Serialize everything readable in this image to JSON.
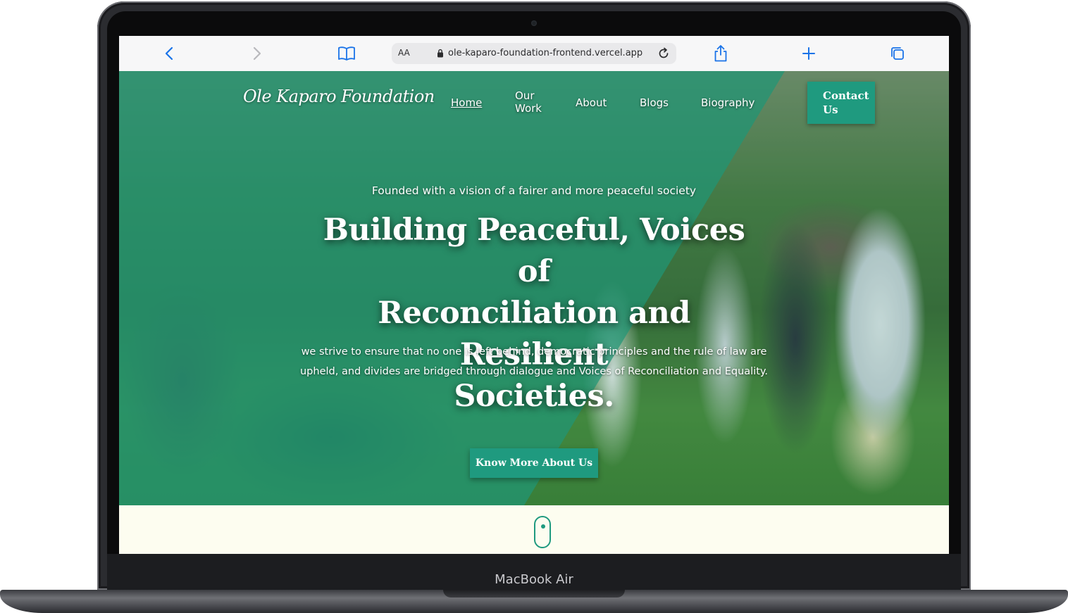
{
  "device": {
    "model_label": "MacBook Air"
  },
  "browser": {
    "address_prefix": "AA",
    "url": "ole-kaparo-foundation-frontend.vercel.app"
  },
  "site": {
    "logo_text": "Ole Kaparo Foundation",
    "nav": {
      "items": [
        {
          "label_line1": "Home",
          "label_line2": ""
        },
        {
          "label_line1": "Our",
          "label_line2": "Work"
        },
        {
          "label_line1": "About",
          "label_line2": ""
        },
        {
          "label_line1": "Blogs",
          "label_line2": ""
        },
        {
          "label_line1": "Biography",
          "label_line2": ""
        }
      ],
      "contact_line1": "Contact",
      "contact_line2": "Us"
    },
    "hero": {
      "subtitle": "Founded with a vision of a fairer and more peaceful society",
      "title_line1": "Building Peaceful, Voices of",
      "title_line2": "Reconciliation and Resilient",
      "title_line3": "Societies.",
      "description_line1": "we strive to ensure that no one is left behind, democratic principles and the rule of law are",
      "description_line2": "upheld, and divides are bridged through dialogue and Voices of Reconciliation and Equality.",
      "cta_label": "Know More About Us"
    }
  },
  "colors": {
    "accent": "#1f9a7f",
    "page_bg": "#fdfdf0",
    "toolbar_icon": "#1a73e8"
  }
}
